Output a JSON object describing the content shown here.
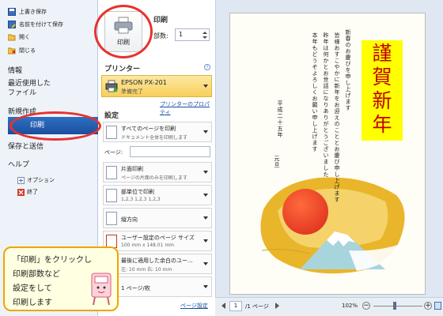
{
  "nav": {
    "quick_commands": [
      "上書き保存",
      "名前を付けて保存",
      "開く",
      "閉じる"
    ],
    "info": "情報",
    "recent_line1": "最近使用した",
    "recent_line2": "ファイル",
    "new": "新規作成",
    "print": "印刷",
    "save_send": "保存と送信",
    "help": "ヘルプ",
    "options": "オプション",
    "exit": "終了"
  },
  "print_section": {
    "heading": "印刷",
    "button_label": "印刷",
    "copies_label": "部数:",
    "copies_value": "1"
  },
  "printer": {
    "heading": "プリンター",
    "name": "EPSON PX-201",
    "status": "準備完了",
    "properties_link": "プリンターのプロパティ"
  },
  "settings": {
    "heading": "設定",
    "pages_label": "ページ:",
    "items": [
      {
        "title": "すべてのページを印刷",
        "sub": "ドキュメント全体を印刷します"
      },
      {
        "title": "片面印刷",
        "sub": "ページの片面のみを印刷します"
      },
      {
        "title": "部単位で印刷",
        "sub": "1,2,3    1,2,3    1,2,3"
      },
      {
        "title": "縦方向",
        "sub": ""
      },
      {
        "title": "ユーザー設定のページ サイズ",
        "sub": "100 mm x 148.01 mm"
      },
      {
        "title": "最後に適用した余白のユー...",
        "sub": "左: 10 mm   右: 10 mm"
      },
      {
        "title": "1 ページ/枚",
        "sub": ""
      }
    ],
    "page_setup_link": "ページ設定"
  },
  "preview": {
    "banner": [
      "謹",
      "賀",
      "新",
      "年"
    ],
    "message_columns": [
      "新春のお慶びを申し上げます",
      "皆様おすこやかに新年をお迎えのこととお慶び申し上げます",
      "昨年は何かとお世話になりありがとうございました",
      "本年もどうぞよろしくお願い申し上げます"
    ],
    "date": "平成二十五年",
    "closing": "元旦"
  },
  "statusbar": {
    "page_current": "1",
    "page_total": "/1 ページ",
    "zoom": "102%"
  },
  "callout": {
    "lines": [
      "「印刷」をクリックし",
      "印刷部数など",
      "設定をして",
      "印刷します"
    ]
  },
  "colors": {
    "highlight_ring": "#e8322e",
    "nav_selected": "#1b4f9e",
    "printer_bg": "#f7cf5a",
    "banner_bg": "#ffff00",
    "banner_text": "#c00000",
    "callout_border": "#f0a500"
  }
}
